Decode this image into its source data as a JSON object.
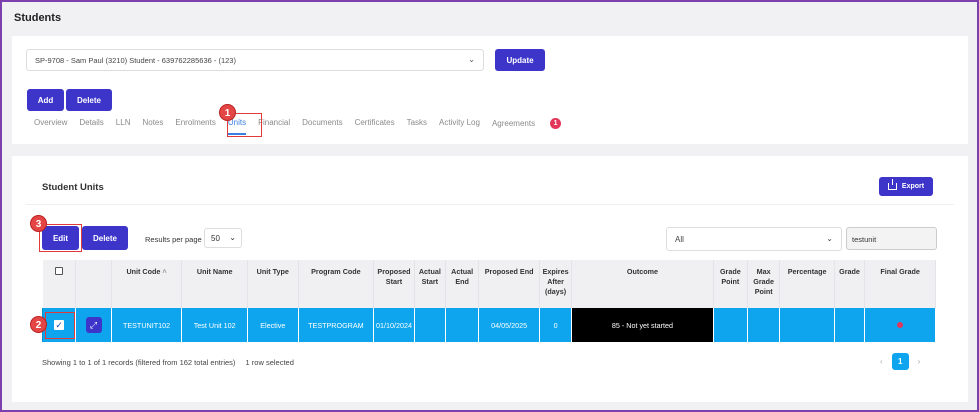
{
  "page_title": "Students",
  "student_select": {
    "value": "SP-9708 - Sam Paul (3210) Student - 639762285636 - (123)"
  },
  "buttons": {
    "update": "Update",
    "add": "Add",
    "delete": "Delete",
    "export": "Export",
    "edit": "Edit",
    "delete_units": "Delete"
  },
  "tabs": [
    {
      "label": "Overview"
    },
    {
      "label": "Details"
    },
    {
      "label": "LLN"
    },
    {
      "label": "Notes"
    },
    {
      "label": "Enrolments"
    },
    {
      "label": "Units",
      "active": true
    },
    {
      "label": "Financial"
    },
    {
      "label": "Documents"
    },
    {
      "label": "Certificates"
    },
    {
      "label": "Tasks"
    },
    {
      "label": "Activity Log"
    },
    {
      "label": "Agreements",
      "badge": "1"
    }
  ],
  "callouts": [
    "1",
    "2",
    "3"
  ],
  "units_section": {
    "title": "Student Units",
    "results_per_page_label": "Results per page",
    "results_per_page_value": "50",
    "filter_value": "All",
    "search_value": "testunit"
  },
  "table": {
    "headers": [
      "Unit Code",
      "Unit Name",
      "Unit Type",
      "Program Code",
      "Proposed Start",
      "Actual Start",
      "Actual End",
      "Proposed End",
      "Expires After (days)",
      "Outcome",
      "Grade Point",
      "Max Grade Point",
      "Percentage",
      "Grade",
      "Final Grade"
    ],
    "row": {
      "unit_code": "TESTUNIT102",
      "unit_name": "Test Unit 102",
      "unit_type": "Elective",
      "program_code": "TESTPROGRAM",
      "proposed_start": "01/10/2024",
      "actual_start": "",
      "actual_end": "",
      "proposed_end": "04/05/2025",
      "expires_after": "0",
      "outcome": "85 - Not yet started",
      "grade_point": "",
      "max_grade_point": "",
      "percentage": "",
      "grade": ""
    }
  },
  "footer": {
    "info": "Showing 1 to 1 of 1 records (filtered from 162 total entries)",
    "selected": "1 row selected",
    "current_page": "1"
  },
  "colors": {
    "primary": "#3d35c9",
    "row_selected": "#0ea5ee",
    "badge": "#e2365a",
    "callout": "#e44545"
  }
}
